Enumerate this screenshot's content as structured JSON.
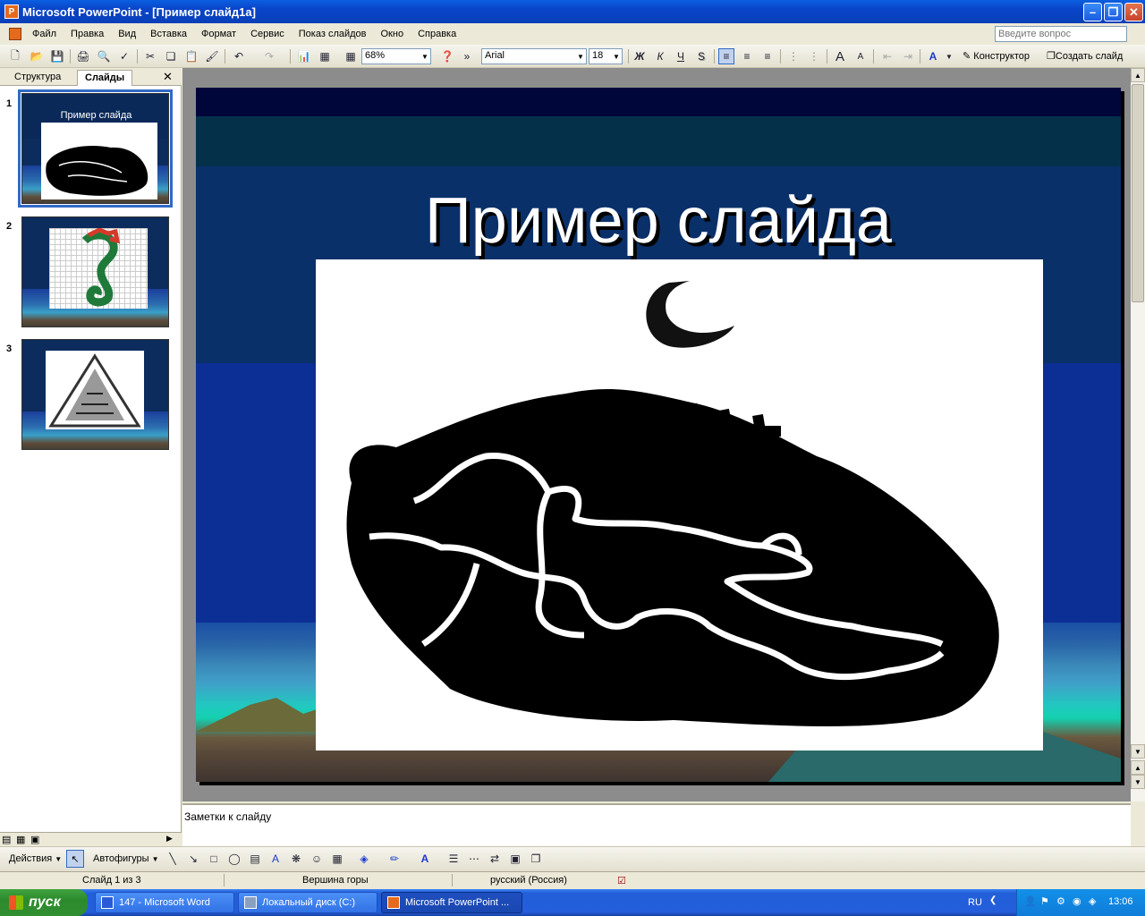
{
  "window": {
    "title": "Microsoft PowerPoint - [Пример слайд1а]",
    "buttons": [
      "minimize",
      "maximize",
      "close"
    ]
  },
  "menu": {
    "items": [
      "Файл",
      "Правка",
      "Вид",
      "Вставка",
      "Формат",
      "Сервис",
      "Показ слайдов",
      "Окно",
      "Справка"
    ],
    "help_placeholder": "Введите вопрос"
  },
  "toolbar": {
    "zoom": "68%",
    "font": "Arial",
    "font_size": "18",
    "bold": "Ж",
    "italic": "К",
    "underline": "Ч",
    "shadow": "S",
    "designer": "Конструктор",
    "new_slide": "Создать слайд"
  },
  "leftpane": {
    "tabs": [
      "Структура",
      "Слайды"
    ],
    "active_tab": "Слайды",
    "thumbnails": [
      {
        "number": "1",
        "title": "Пример слайда",
        "selected": true
      },
      {
        "number": "2",
        "title": "",
        "selected": false
      },
      {
        "number": "3",
        "title": "",
        "selected": false
      }
    ]
  },
  "slide": {
    "title": "Пример слайда"
  },
  "notes": {
    "placeholder": "Заметки к слайду"
  },
  "drawing": {
    "actions": "Действия",
    "autoshapes": "Автофигуры"
  },
  "status": {
    "slide_counter": "Слайд 1 из 3",
    "design": "Вершина горы",
    "language": "русский (Россия)"
  },
  "taskbar": {
    "start": "пуск",
    "items": [
      {
        "label": "147 - Microsoft Word",
        "active": false
      },
      {
        "label": "Локальный диск (C:)",
        "active": false
      },
      {
        "label": "Microsoft PowerPoint ...",
        "active": true
      }
    ],
    "lang": "RU",
    "clock": "13:06"
  },
  "colors": {
    "accent": "#0a44c8",
    "slide_bg": "#0c2d63",
    "selection": "#316ac5"
  }
}
